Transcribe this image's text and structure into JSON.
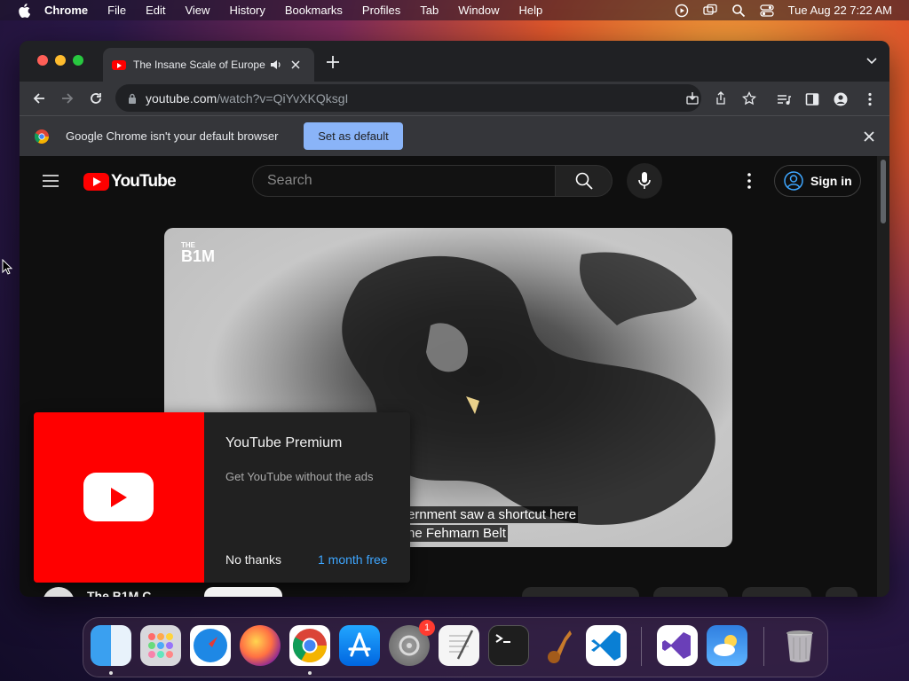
{
  "menubar": {
    "app_name": "Chrome",
    "items": [
      "File",
      "Edit",
      "View",
      "History",
      "Bookmarks",
      "Profiles",
      "Tab",
      "Window",
      "Help"
    ],
    "clock": "Tue Aug 22  7:22 AM",
    "status_icons": [
      "screen-record-icon",
      "screen-mirroring-icon",
      "spotlight-icon",
      "control-center-icon"
    ]
  },
  "browser": {
    "tab_title": "The Insane Scale of Europe",
    "url_host": "youtube.com",
    "url_path": "/watch?v=QiYvXKQksgI",
    "infobar_message": "Google Chrome isn't your default browser",
    "set_default_label": "Set as default"
  },
  "youtube": {
    "logo_text": "YouTube",
    "search_placeholder": "Search",
    "sign_in_label": "Sign in",
    "video": {
      "brand_small": "THE",
      "brand_big": "B1M",
      "caption_line1": "ernment saw a shortcut here",
      "caption_line2": "he Fehmarn Belt"
    },
    "promo": {
      "title": "YouTube Premium",
      "subtitle": "Get YouTube without the ads",
      "dismiss_label": "No thanks",
      "cta_label": "1 month free"
    },
    "channel_name_partial": "The B1M C"
  },
  "dock": {
    "apps": [
      "Finder",
      "Launchpad",
      "Safari",
      "Firefox",
      "Google Chrome",
      "App Store",
      "System Settings",
      "TextEdit",
      "Terminal",
      "Instruments",
      "Visual Studio Code",
      "Visual Studio",
      "Weather",
      "Trash"
    ],
    "settings_badge": "1"
  },
  "colors": {
    "youtube_red": "#ff0000",
    "chrome_blue": "#8ab4f8",
    "link_blue": "#3ea6ff"
  }
}
